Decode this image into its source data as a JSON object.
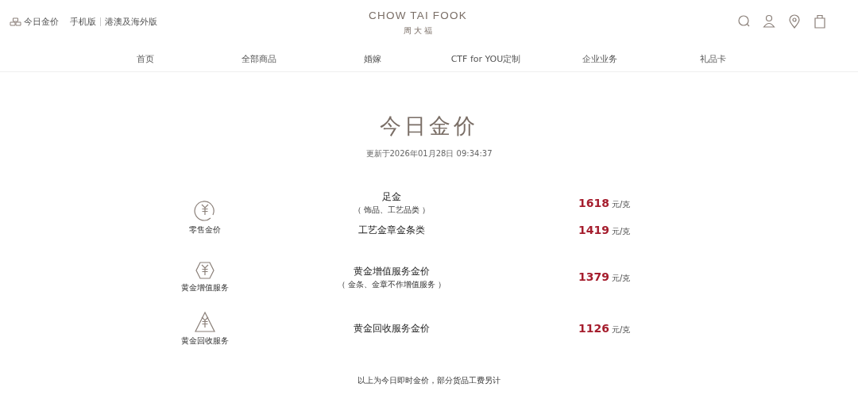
{
  "header": {
    "gold_price_link": "今日金价",
    "links": [
      "手机版",
      "港澳及海外版"
    ],
    "logo": {
      "name": "CHOW TAI FOOK",
      "chinese": "周 大 福"
    }
  },
  "nav": [
    "首页",
    "全部商品",
    "婚嫁",
    "CTF for YOU定制",
    "企业业务",
    "礼品卡"
  ],
  "title": "今日金价",
  "updated": "更新于2026年01月28日 09:34:37",
  "sections": [
    {
      "kind": "circle",
      "label": "零售金价",
      "items": [
        {
          "name": "足金",
          "note": "（ 饰品、工艺品类 ）",
          "price": "1618",
          "unit": "元/克"
        },
        {
          "name": "工艺金章金条类",
          "price": "1419",
          "unit": "元/克"
        }
      ]
    },
    {
      "kind": "hexagon",
      "label": "黄金增值服务",
      "items": [
        {
          "name": "黄金增值服务金价",
          "note": "（ 金条、金章不作增值服务 ）",
          "price": "1379",
          "unit": "元/克"
        }
      ]
    },
    {
      "kind": "triangle",
      "label": "黄金回收服务",
      "items": [
        {
          "name": "黄金回收服务金价",
          "price": "1126",
          "unit": "元/克"
        }
      ]
    }
  ],
  "footnote": "以上为今日即时金价，部分货品工费另计"
}
